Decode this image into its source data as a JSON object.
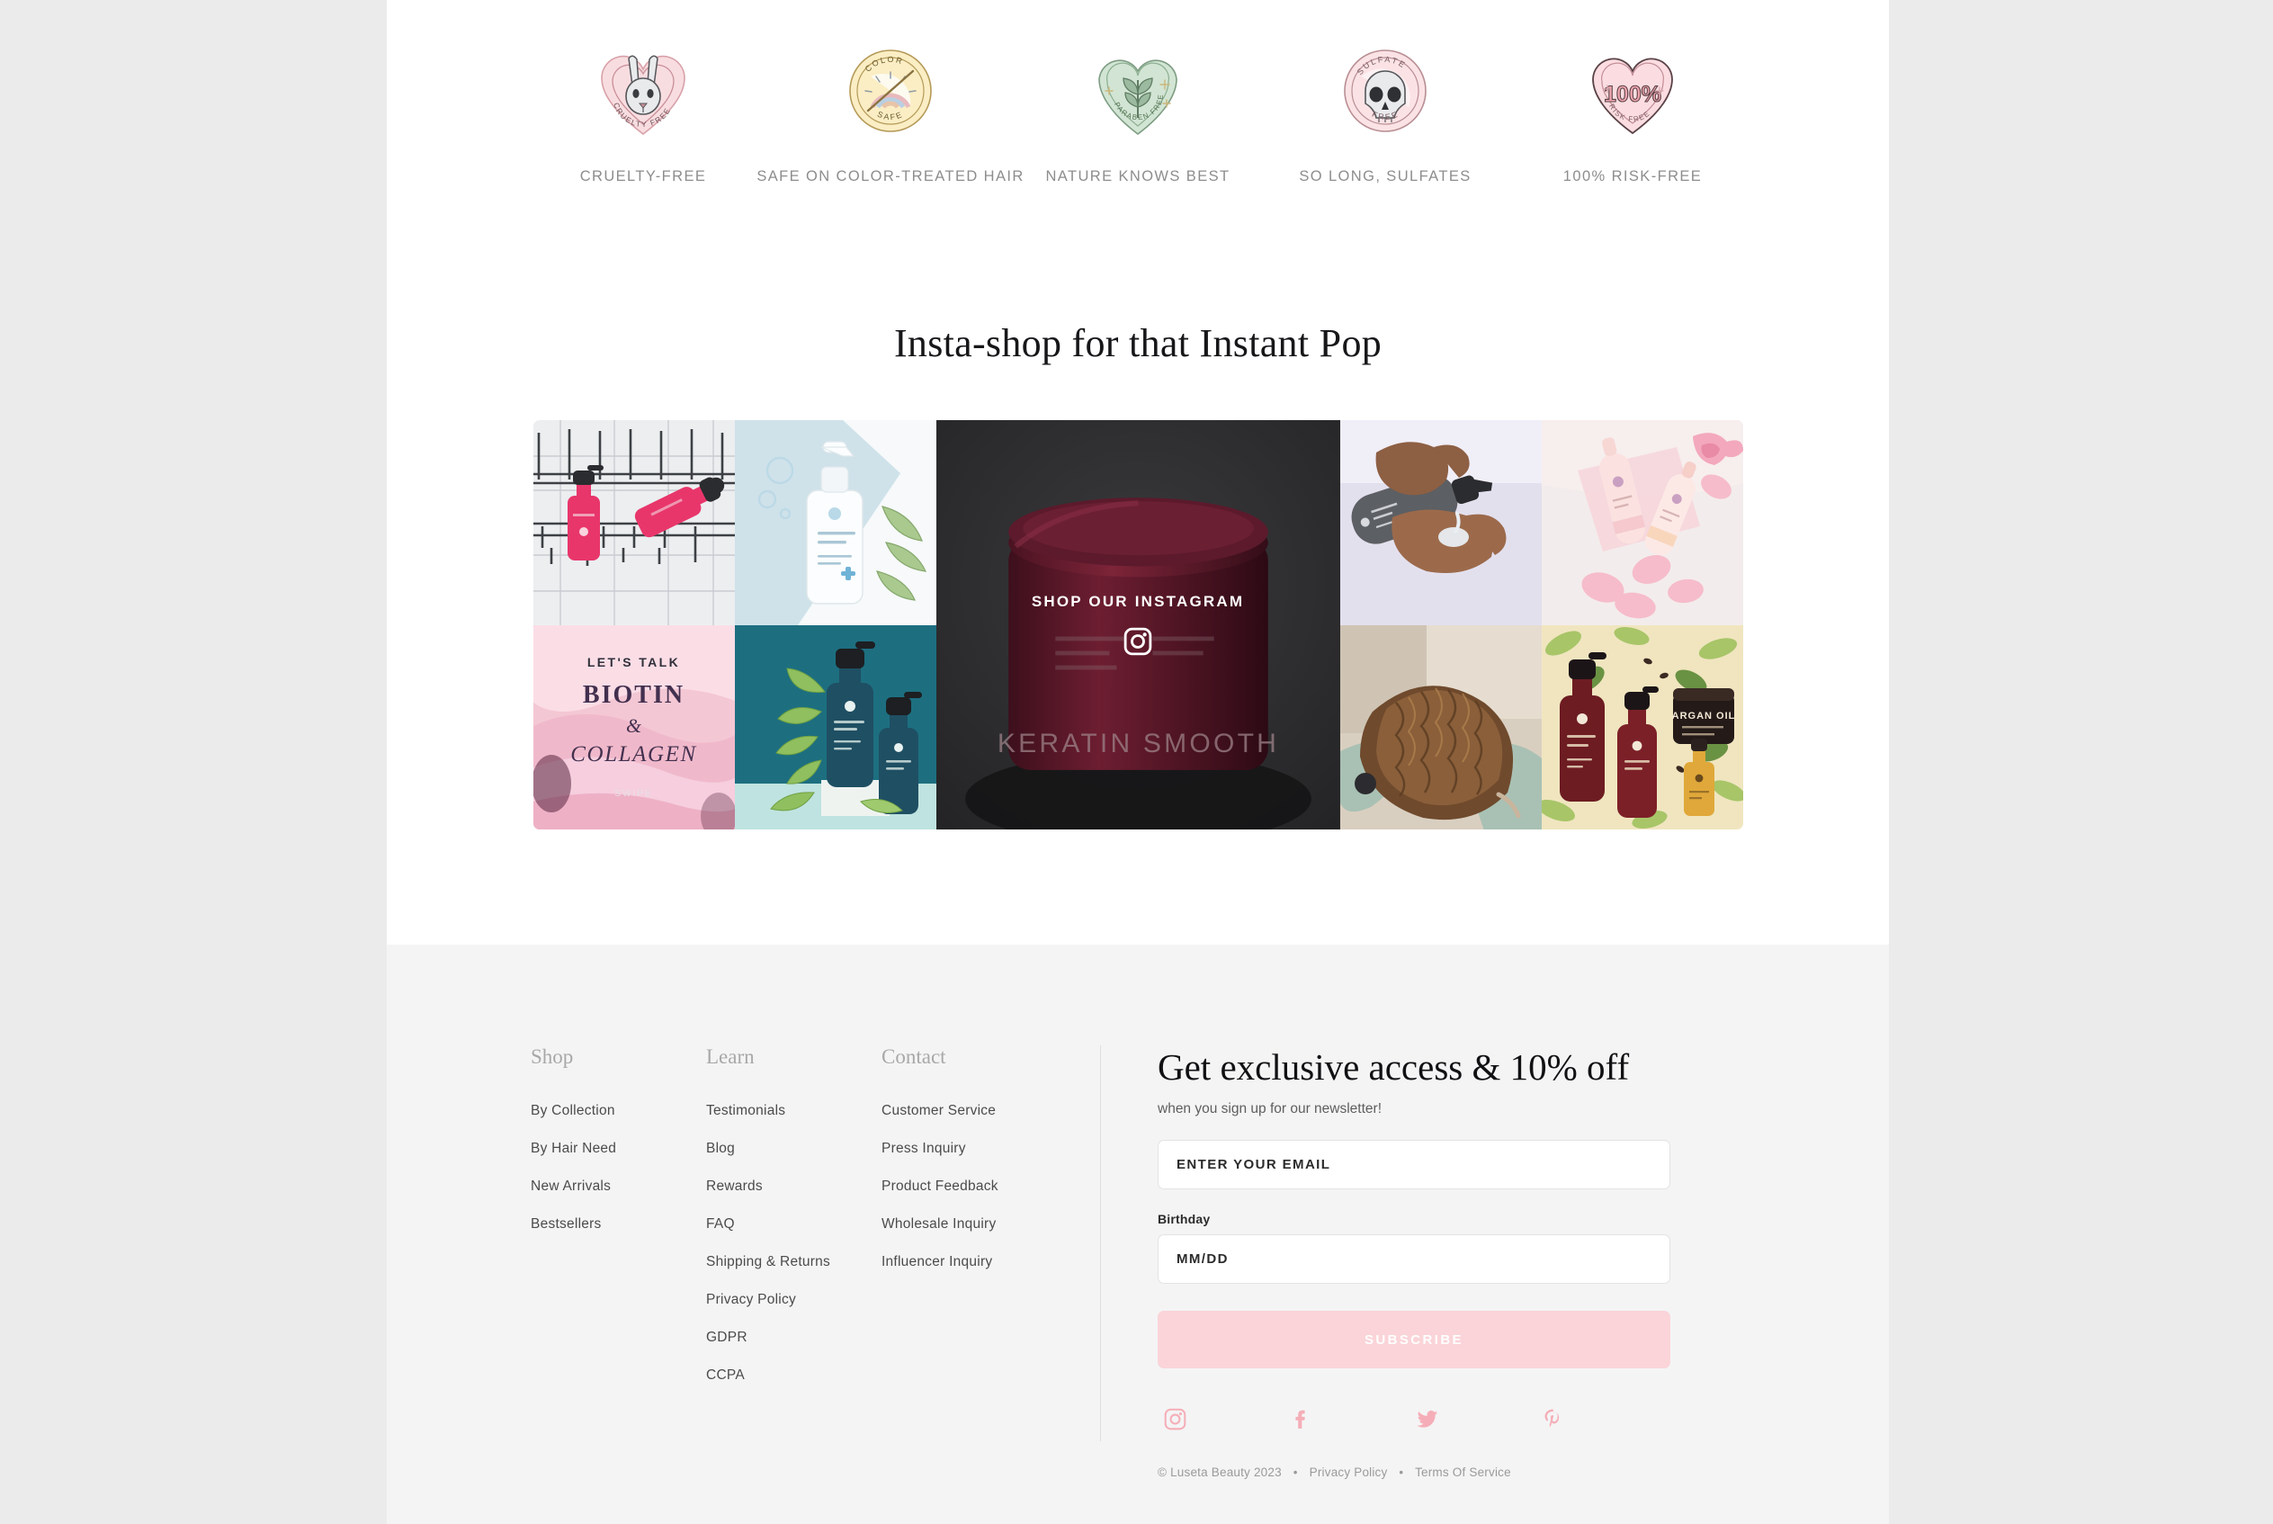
{
  "badges": [
    {
      "label": "CRUELTY-FREE",
      "icon": "bunny-heart-badge-icon",
      "ring_text_top": "CRUELTY",
      "ring_text_bottom": "FREE",
      "color": "#f6d7da"
    },
    {
      "label": "SAFE ON COLOR-TREATED HAIR",
      "icon": "rainbow-color-safe-badge-icon",
      "ring_text_top": "COLOR",
      "ring_text_bottom": "SAFE",
      "color": "#fbeec4"
    },
    {
      "label": "NATURE KNOWS BEST",
      "icon": "leaf-heart-paraben-free-badge-icon",
      "ring_text_top": "PARABEN",
      "ring_text_bottom": "FREE",
      "color": "#cfe3d2"
    },
    {
      "label": "SO LONG, SULFATES",
      "icon": "skull-sulfate-free-badge-icon",
      "ring_text_top": "SULFATE",
      "ring_text_bottom": "FREE",
      "color": "#f8dcdf"
    },
    {
      "label": "100% RISK-FREE",
      "icon": "heart-100-risk-free-badge-icon",
      "ring_text_top": "100%",
      "ring_text_bottom": "RISK FREE",
      "color": "#f8d9dd"
    }
  ],
  "instagram": {
    "heading": "Insta-shop for that Instant Pop",
    "cta_label": "SHOP OUR INSTAGRAM",
    "cta_icon": "instagram-icon",
    "tiles": [
      {
        "name": "pink-bottles-in-shower-caddy",
        "caption": ""
      },
      {
        "name": "white-blue-bottle-with-aloe",
        "caption": ""
      },
      {
        "name": "biotin-collagen-promo",
        "caption_top": "LET'S TALK",
        "caption_main": "BIOTIN",
        "caption_amp": "&",
        "caption_sub": "COLLAGEN",
        "caption_swipe": "SWIPE"
      },
      {
        "name": "teal-bottles-with-leaves",
        "caption": ""
      },
      {
        "name": "hands-dispensing-product",
        "caption": ""
      },
      {
        "name": "rose-products-flatlay",
        "caption": ""
      },
      {
        "name": "curly-hair-back-view",
        "caption": ""
      },
      {
        "name": "argan-oil-collection",
        "caption": "ARGAN OIL"
      }
    ],
    "center_tile": {
      "name": "keratin-smooth-mask-jar",
      "product_text": "KERATIN SMOOTH"
    }
  },
  "footer": {
    "columns": [
      {
        "title": "Shop",
        "links": [
          "By Collection",
          "By Hair Need",
          "New Arrivals",
          "Bestsellers"
        ]
      },
      {
        "title": "Learn",
        "links": [
          "Testimonials",
          "Blog",
          "Rewards",
          "FAQ",
          "Shipping & Returns",
          "Privacy Policy",
          "GDPR",
          "CCPA"
        ]
      },
      {
        "title": "Contact",
        "links": [
          "Customer Service",
          "Press Inquiry",
          "Product Feedback",
          "Wholesale Inquiry",
          "Influencer Inquiry"
        ]
      }
    ],
    "newsletter": {
      "title": "Get exclusive access & 10% off",
      "subtitle": "when you sign up for our newsletter!",
      "email_placeholder": "ENTER YOUR EMAIL",
      "birthday_label": "Birthday",
      "birthday_placeholder": "MM/DD",
      "subscribe_label": "SUBSCRIBE",
      "button_color": "#fad4d8"
    },
    "socials": [
      {
        "name": "instagram-icon"
      },
      {
        "name": "facebook-icon"
      },
      {
        "name": "twitter-icon"
      },
      {
        "name": "pinterest-icon"
      }
    ],
    "social_color": "#f5aeb7",
    "legal": {
      "copyright": "© Luseta Beauty 2023",
      "sep1": "•",
      "privacy": "Privacy Policy",
      "sep2": "•",
      "terms": "Terms Of Service"
    }
  }
}
